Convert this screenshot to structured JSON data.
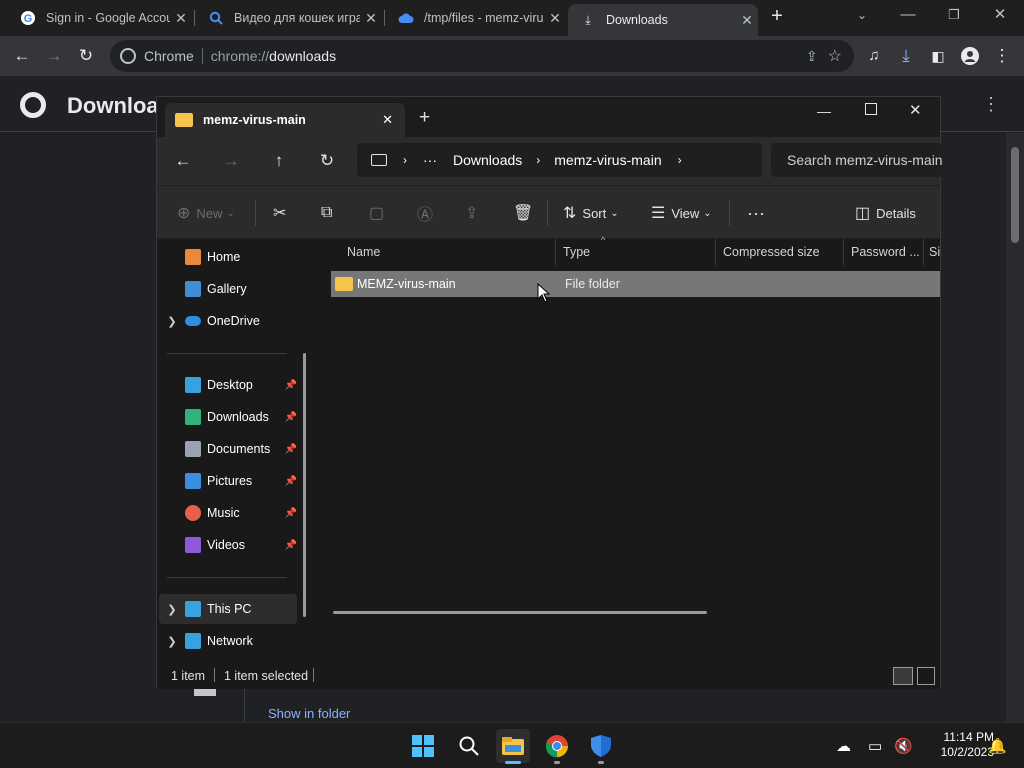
{
  "browser": {
    "tabs": [
      {
        "title": "Sign in - Google Accou",
        "icon": "google-icon"
      },
      {
        "title": "Видео для кошек игра",
        "icon": "search-icon"
      },
      {
        "title": "/tmp/files - memz-viru",
        "icon": "cloud-icon"
      },
      {
        "title": "Downloads",
        "icon": "download-icon",
        "active": true
      }
    ],
    "omnibox": {
      "site": "Chrome",
      "url_prefix": "chrome://",
      "url_path": "downloads"
    },
    "page": {
      "title": "Downloa",
      "show_in_folder": "Show in folder"
    }
  },
  "explorer": {
    "tab_title": "memz-virus-main",
    "breadcrumb": [
      "Downloads",
      "memz-virus-main"
    ],
    "search_placeholder": "Search memz-virus-main",
    "commands": {
      "new": "New",
      "sort": "Sort",
      "view": "View",
      "details": "Details"
    },
    "sidebar": {
      "top": [
        {
          "label": "Home",
          "icon": "home-icon",
          "color": "#e88a3e"
        },
        {
          "label": "Gallery",
          "icon": "gallery-icon",
          "color": "#3f8fd6"
        },
        {
          "label": "OneDrive",
          "icon": "onedrive-icon",
          "color": "#2f8ee0"
        }
      ],
      "pinned": [
        {
          "label": "Desktop",
          "icon": "desktop-icon",
          "color": "#3aa0e0"
        },
        {
          "label": "Downloads",
          "icon": "downloads-icon",
          "color": "#2fb37a"
        },
        {
          "label": "Documents",
          "icon": "documents-icon",
          "color": "#9aa4b1"
        },
        {
          "label": "Pictures",
          "icon": "pictures-icon",
          "color": "#3c8fdc"
        },
        {
          "label": "Music",
          "icon": "music-icon",
          "color": "#e4624c"
        },
        {
          "label": "Videos",
          "icon": "videos-icon",
          "color": "#8e5ad8"
        }
      ],
      "bottom": [
        {
          "label": "This PC",
          "icon": "this-pc-icon",
          "color": "#3aa0e0"
        },
        {
          "label": "Network",
          "icon": "network-icon",
          "color": "#3aa0e0"
        }
      ]
    },
    "columns": [
      "Name",
      "Type",
      "Compressed size",
      "Password ...",
      "Si"
    ],
    "rows": [
      {
        "name": "MEMZ-virus-main",
        "type": "File folder"
      }
    ],
    "status": {
      "count": "1 item",
      "selected": "1 item selected"
    }
  },
  "taskbar": {
    "clock_time": "11:14 PM",
    "clock_date": "10/2/2023"
  }
}
